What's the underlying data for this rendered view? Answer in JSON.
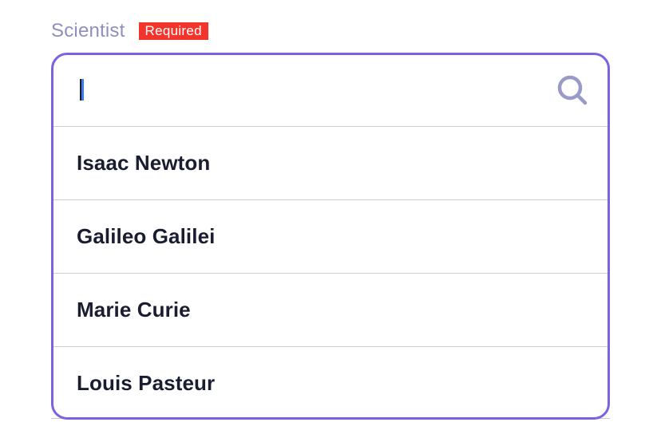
{
  "field": {
    "label": "Scientist",
    "badge": "Required"
  },
  "search": {
    "value": "",
    "icon": "search-icon"
  },
  "options": [
    {
      "label": "Isaac Newton"
    },
    {
      "label": "Galileo Galilei"
    },
    {
      "label": "Marie Curie"
    },
    {
      "label": "Louis Pasteur"
    }
  ],
  "colors": {
    "accent": "#7d62e0",
    "label": "#8f8fbf",
    "badge": "#f3342c",
    "text": "#1a1c30",
    "caret": "#3d7be8",
    "divider": "#cfcfd6"
  }
}
